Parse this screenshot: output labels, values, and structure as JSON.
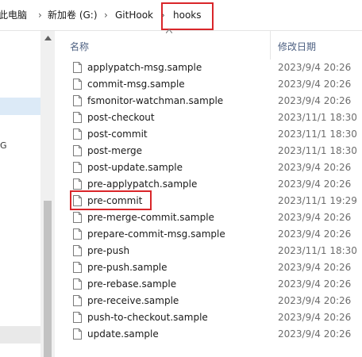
{
  "breadcrumb": {
    "items": [
      "此电脑",
      "新加卷 (G:)",
      "GitHook",
      "hooks"
    ],
    "separator": "›"
  },
  "nav": {
    "partial_label": "G"
  },
  "columns": {
    "name": "名称",
    "date": "修改日期"
  },
  "files": [
    {
      "name": "applypatch-msg.sample",
      "date": "2023/9/4 20:26"
    },
    {
      "name": "commit-msg.sample",
      "date": "2023/9/4 20:26"
    },
    {
      "name": "fsmonitor-watchman.sample",
      "date": "2023/9/4 20:26"
    },
    {
      "name": "post-checkout",
      "date": "2023/11/1 18:30"
    },
    {
      "name": "post-commit",
      "date": "2023/11/1 18:30"
    },
    {
      "name": "post-merge",
      "date": "2023/11/1 18:30"
    },
    {
      "name": "post-update.sample",
      "date": "2023/9/4 20:26"
    },
    {
      "name": "pre-applypatch.sample",
      "date": "2023/9/4 20:26"
    },
    {
      "name": "pre-commit",
      "date": "2023/11/1 19:29"
    },
    {
      "name": "pre-merge-commit.sample",
      "date": "2023/9/4 20:26"
    },
    {
      "name": "prepare-commit-msg.sample",
      "date": "2023/9/4 20:26"
    },
    {
      "name": "pre-push",
      "date": "2023/11/1 18:30"
    },
    {
      "name": "pre-push.sample",
      "date": "2023/9/4 20:26"
    },
    {
      "name": "pre-rebase.sample",
      "date": "2023/9/4 20:26"
    },
    {
      "name": "pre-receive.sample",
      "date": "2023/9/4 20:26"
    },
    {
      "name": "push-to-checkout.sample",
      "date": "2023/9/4 20:26"
    },
    {
      "name": "update.sample",
      "date": "2023/9/4 20:26"
    }
  ],
  "icons": {
    "file": "file-icon",
    "sort": "sort-caret-icon",
    "scroll_up": "scroll-up-icon"
  },
  "colors": {
    "highlight_box": "#d9262a",
    "header_text": "#4d6082",
    "date_text": "#6d6d6d",
    "nav_selected": "#dceaf7"
  }
}
